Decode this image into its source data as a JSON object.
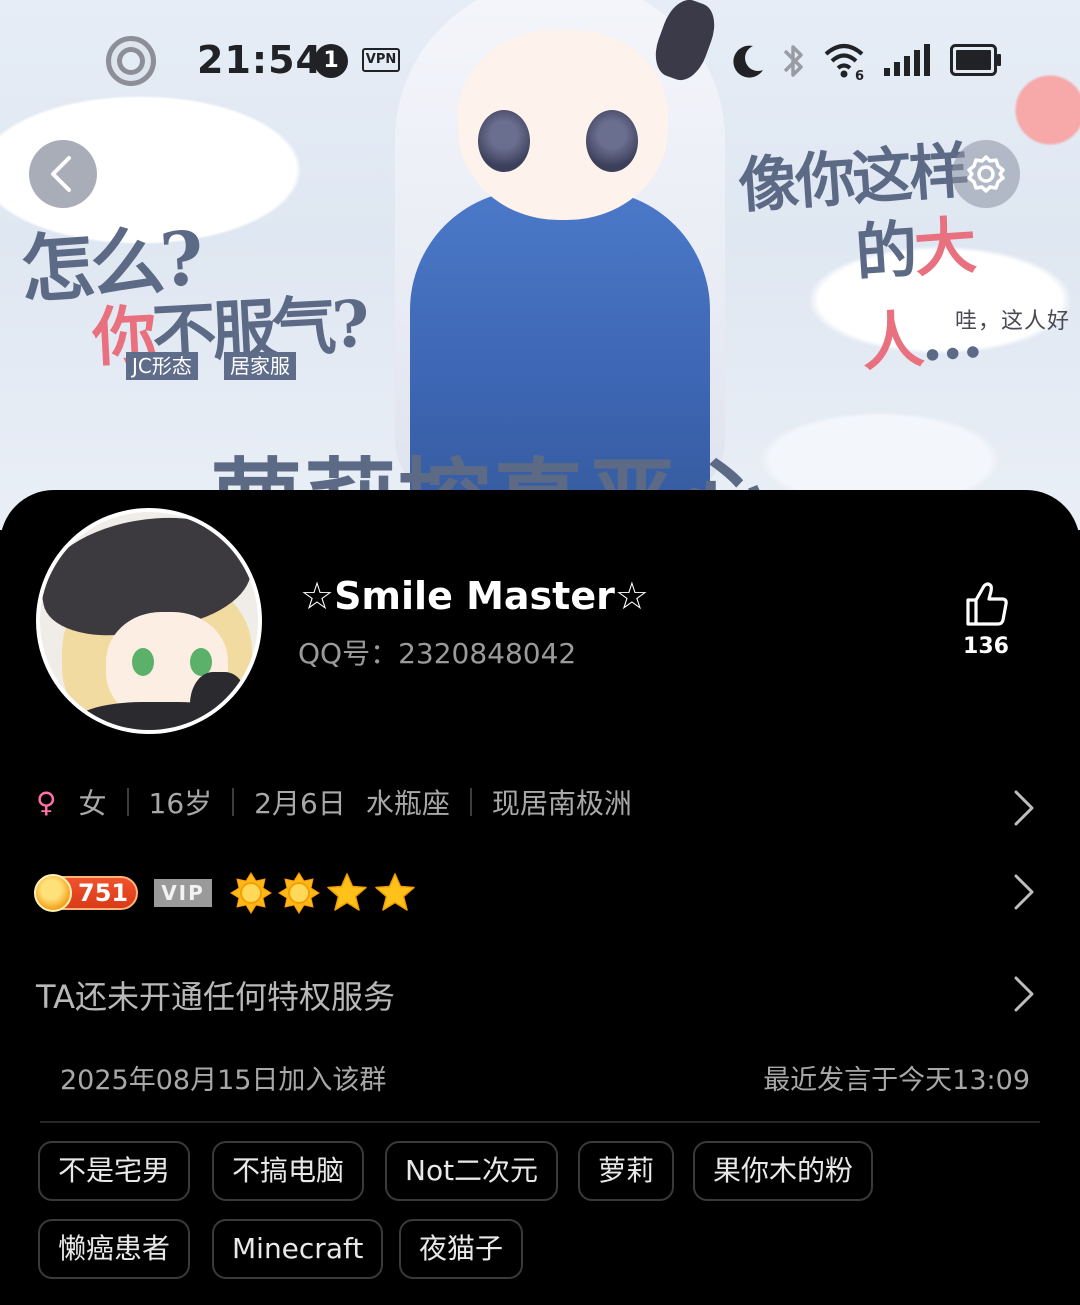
{
  "status_bar": {
    "time": "21:54",
    "notification_count": "1",
    "vpn_label": "VPN",
    "wifi_sub": "6",
    "icons": [
      "ring-icon",
      "moon-icon",
      "bluetooth-icon",
      "wifi-icon",
      "signal-icon",
      "battery-icon"
    ]
  },
  "banner": {
    "text_left_1": "怎么?",
    "text_left_2_pink": "你",
    "text_left_2_rest": "不服气?",
    "chip_1": "JC形态",
    "chip_2": "居家服",
    "text_right_1": "像你这样",
    "text_right_2_plain": "的",
    "text_right_2_pink": "大人",
    "text_right_2_tail": "…",
    "text_right_3": "哇，这人好",
    "text_bottom": "萝莉控真恶心"
  },
  "profile": {
    "nickname": "☆Smile Master☆",
    "qq": "QQ号：2320848042",
    "like_count": "136"
  },
  "info": {
    "gender_symbol": "♀",
    "gender": "女",
    "age": "16岁",
    "birthday": "2月6日",
    "zodiac": "水瓶座",
    "location": "现居南极洲"
  },
  "level": {
    "value": "751",
    "vip_label": "VIP",
    "icons": [
      "sun-icon",
      "sun-icon",
      "star-icon",
      "star-icon"
    ]
  },
  "privilege_text": "TA还未开通任何特权服务",
  "group": {
    "joined": "2025年08月15日加入该群",
    "last_speak": "最近发言于今天13:09"
  },
  "tags": [
    "不是宅男",
    "不搞电脑",
    "Not二次元",
    "萝莉",
    "果你木的粉",
    "懒癌患者",
    "Minecraft",
    "夜猫子"
  ],
  "colors": {
    "background": "#000000",
    "female": "#ff6fa8",
    "level_badge": "#e2451f",
    "star": "#ffc21a"
  }
}
